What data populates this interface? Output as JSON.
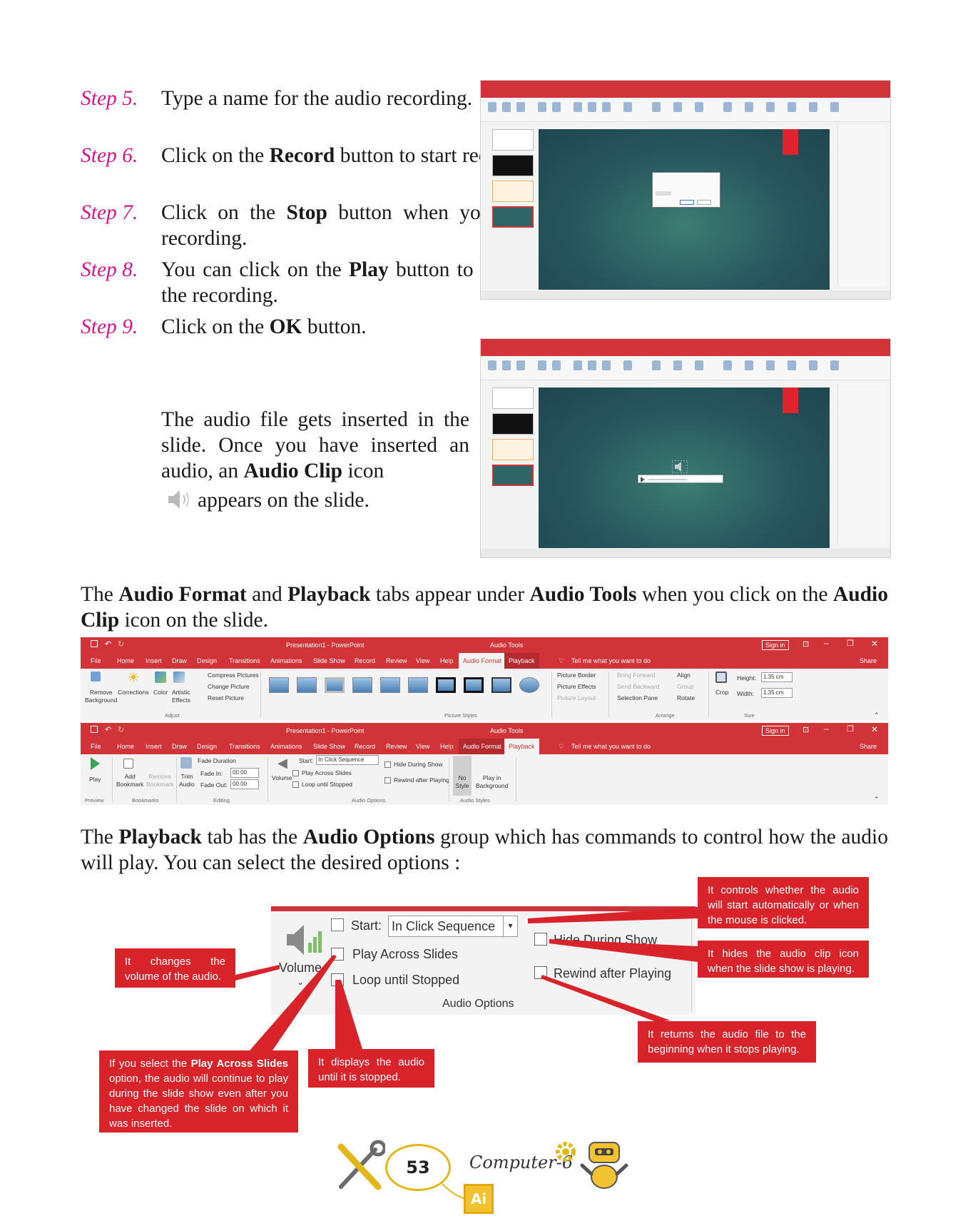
{
  "steps": [
    {
      "num": "Step 5.",
      "parts": [
        "Type a name for the audio recording."
      ]
    },
    {
      "num": "Step 6.",
      "pre": "Click on the ",
      "bold": "Record",
      "post": " button to start recording."
    },
    {
      "num": "Step 7.",
      "pre": "Click on the ",
      "bold": "Stop",
      "post": " button when you finish recording."
    },
    {
      "num": "Step 8.",
      "pre": "You can click on the ",
      "bold": "Play",
      "post": " button to listen to the recording."
    },
    {
      "num": "Step 9.",
      "pre": "Click on the ",
      "bold": "OK",
      "post": " button."
    }
  ],
  "audio_inserted": {
    "text1": "The audio file gets inserted in the slide. Once you have inserted an audio, an ",
    "bold": "Audio Clip",
    "text2": " icon",
    "text3": "appears on the slide."
  },
  "tabs_para": {
    "t1": "The ",
    "b1": "Audio Format",
    "t2": " and ",
    "b2": "Playback",
    "t3": " tabs appear under ",
    "b3": "Audio Tools",
    "t4": " when you click on the ",
    "b4": "Audio Clip",
    "t5": " icon on the slide."
  },
  "ribbon_common": {
    "doc_title": "Presentation1 - PowerPoint",
    "tools_title": "Audio Tools",
    "sign_in": "Sign in",
    "tell_me": "Tell me what you want to do",
    "share": "Share",
    "tabs": [
      "File",
      "Home",
      "Insert",
      "Draw",
      "Design",
      "Transitions",
      "Animations",
      "Slide Show",
      "Record",
      "Review",
      "View",
      "Help",
      "Audio Format",
      "Playback"
    ]
  },
  "format_ribbon": {
    "remove_background": [
      "Remove",
      "Background"
    ],
    "corrections": "Corrections",
    "color": "Color",
    "artistic_effects": [
      "Artistic",
      "Effects"
    ],
    "compress_pictures": "Compress Pictures",
    "change_picture": "Change Picture",
    "reset_picture": "Reset Picture",
    "adjust_label": "Adjust",
    "picture_styles_label": "Picture Styles",
    "picture_border": "Picture Border",
    "picture_effects": "Picture Effects",
    "picture_layout": "Picture Layout",
    "bring_forward": "Bring Forward",
    "send_backward": "Send Backward",
    "selection_pane": "Selection Pane",
    "align": "Align",
    "group": "Group",
    "rotate": "Rotate",
    "arrange_label": "Arrange",
    "crop": "Crop",
    "height_label": "Height:",
    "height_value": "1.35 cm",
    "width_label": "Width:",
    "width_value": "1.35 cm",
    "size_label": "Size"
  },
  "playback_ribbon": {
    "play": "Play",
    "preview_label": "Preview",
    "add_bookmark": [
      "Add",
      "Bookmark"
    ],
    "remove_bookmark": [
      "Remove",
      "Bookmark"
    ],
    "bookmarks_label": "Bookmarks",
    "trim_audio": [
      "Trim",
      "Audio"
    ],
    "fade_duration": "Fade Duration",
    "fade_in_label": "Fade In:",
    "fade_in_value": "00.00",
    "fade_out_label": "Fade Out:",
    "fade_out_value": "00.00",
    "editing_label": "Editing",
    "volume": "Volume",
    "start_label": "Start:",
    "start_value": "In Click Sequence",
    "play_across": "Play Across Slides",
    "loop": "Loop until Stopped",
    "hide": "Hide During Show",
    "rewind": "Rewind after Playing",
    "audio_options_label": "Audio Options",
    "no_style": [
      "No",
      "Style"
    ],
    "play_in_background": [
      "Play in",
      "Background"
    ],
    "audio_styles_label": "Audio Styles"
  },
  "playback_para": {
    "t1": "The ",
    "b1": "Playback",
    "t2": " tab has the ",
    "b2": "Audio Options",
    "t3": " group which has commands to control how the audio will play. You can select the desired options :"
  },
  "callout_figure": {
    "volume": "Volume",
    "start_label": "Start:",
    "start_value": "In Click Sequence",
    "play_across": "Play Across Slides",
    "loop": "Loop until Stopped",
    "hide": "Hide During Show",
    "rewind": "Rewind after Playing",
    "group_label": "Audio Options",
    "callouts": {
      "start": "It controls whether the audio will start automatically or when the mouse is clicked.",
      "volume": "It changes the volume of the audio.",
      "hide": "It hides the audio clip icon when the slide show is playing.",
      "rewind": "It returns the audio file to the beginning when it stops playing.",
      "play_across_pre": "If you select the ",
      "play_across_bold": "Play Across Slides",
      "play_across_post": " option, the audio will continue to play during the slide show even after you have changed the slide on which it was inserted.",
      "loop": "It displays the audio until it is stopped."
    }
  },
  "footer": {
    "page_number": "53",
    "book_name": "Computer-6",
    "ai_badge": "Ai"
  },
  "colors": {
    "step_magenta": "#d6158a",
    "ribbon_red": "#d13438",
    "callout_red": "#d8232a",
    "badge_gold": "#e2b719"
  }
}
